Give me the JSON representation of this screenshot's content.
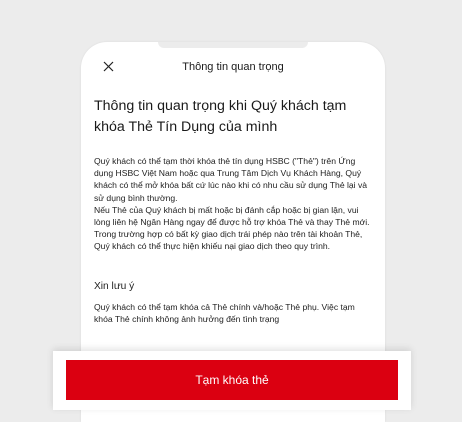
{
  "header": {
    "title": "Thông tin quan trọng",
    "close_icon": "close-icon"
  },
  "main": {
    "heading": "Thông tin quan trọng khi Quý khách tạm khóa Thẻ Tín Dụng của mình",
    "paragraph_1": "Quý khách có thể tạm thời khóa thẻ tín dụng HSBC (\"Thẻ\") trên Ứng dụng HSBC Việt Nam hoặc qua Trung Tâm Dịch Vụ Khách Hàng, Quý khách có thể mở khóa bất cứ lúc nào khi có nhu cầu sử dụng Thẻ lại và sử dụng bình thường.",
    "paragraph_2": "Nếu Thẻ của Quý khách bị mất hoặc bị đánh cắp hoặc bị gian lận, vui lòng liên hệ Ngân Hàng ngay để được hỗ trợ khóa Thẻ và thay Thẻ mới. Trong trường hợp có bất kỳ giao dịch trái phép nào trên tài khoản Thẻ, Quý khách có thể thực hiện khiếu nại giao dịch theo quy trình.",
    "note_title": "Xin lưu ý",
    "note_text": "Quý khách có thể tạm khóa cả Thẻ chính và/hoặc Thẻ phụ. Việc tạm khóa Thẻ chính không ảnh hưởng đến tình trạng"
  },
  "footer": {
    "button_label": "Tạm khóa thẻ",
    "button_color": "#db0011"
  }
}
